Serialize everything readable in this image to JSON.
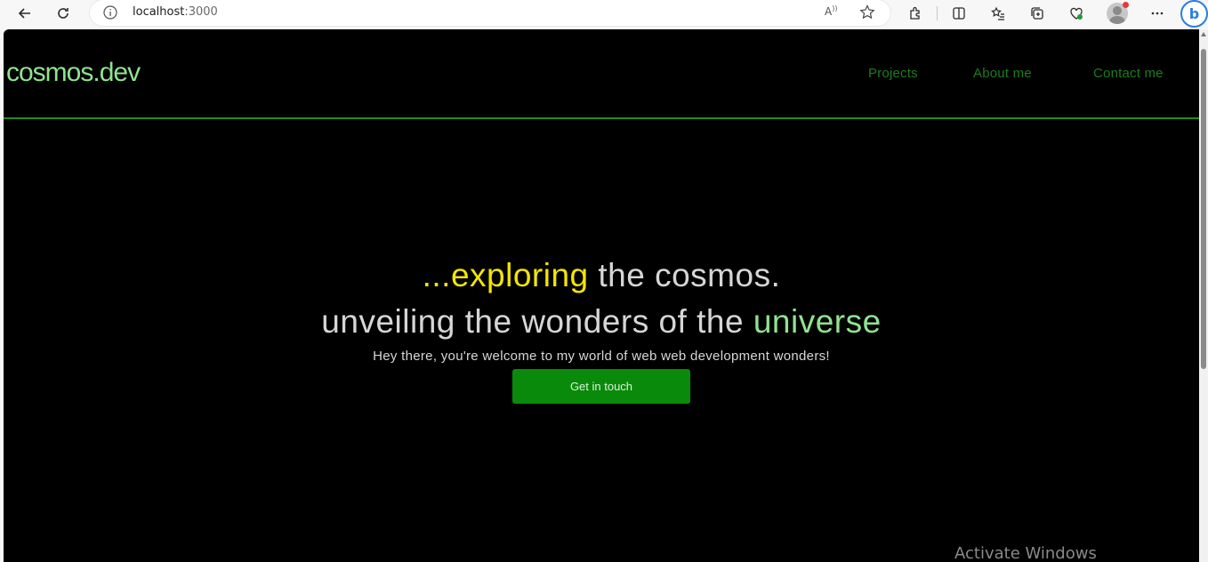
{
  "browser": {
    "url_host": "localhost",
    "url_port": ":3000",
    "read_aloud_label": "A",
    "bing_label": "b"
  },
  "nav": {
    "logo": "cosmos.dev",
    "links": [
      "Projects",
      "About me",
      "Contact me"
    ]
  },
  "hero": {
    "line1_highlight": "...exploring",
    "line1_rest": " the cosmos.",
    "line2_rest": "unveiling the wonders of the ",
    "line2_highlight": "universe",
    "subtitle": "Hey there, you're welcome to my world of web web development wonders!",
    "cta": "Get in touch"
  },
  "os": {
    "watermark": "Activate Windows"
  },
  "colors": {
    "page_bg": "#000000",
    "logo": "#8fe38f",
    "nav_link": "#1c7d1c",
    "accent_yellow": "#f2e600",
    "accent_green": "#8fe38f",
    "button": "#0a8a0a"
  }
}
